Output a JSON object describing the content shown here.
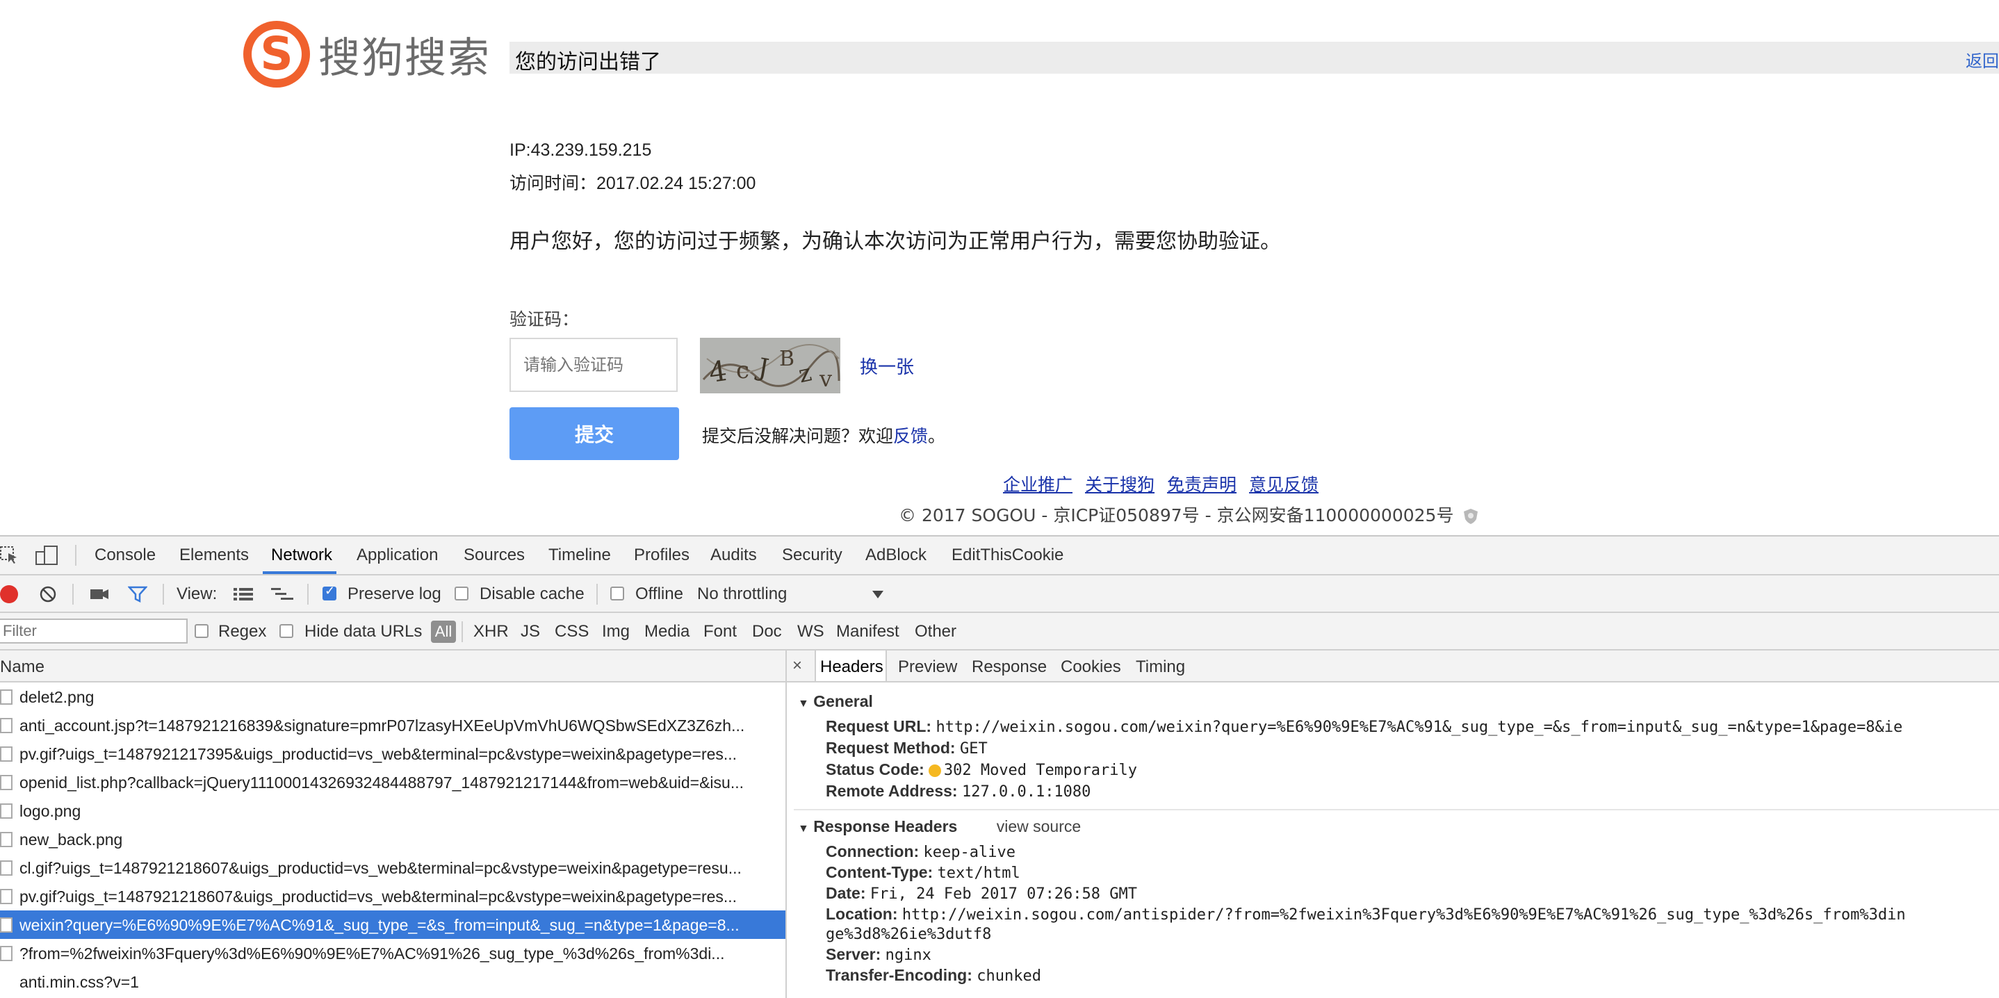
{
  "sogou": {
    "logo_text": "搜狗搜索",
    "logo_letter": "S",
    "title": "您的访问出错了",
    "back_link": "返回",
    "ip": "IP:43.239.159.215",
    "visit_time": "访问时间：2017.02.24 15:27:00",
    "message": "用户您好，您的访问过于频繁，为确认本次访问为正常用户行为，需要您协助验证。",
    "captcha_label": "验证码：",
    "captcha_placeholder": "请输入验证码",
    "refresh_link": "换一张",
    "submit_label": "提交",
    "after_text": "提交后没解决问题？欢迎",
    "after_link": "反馈",
    "after_end": "。",
    "footer_links": [
      "企业推广",
      "关于搜狗",
      "免责声明",
      "意见反馈"
    ],
    "copyright": "© 2017 SOGOU - 京ICP证050897号 - 京公网安备110000000025号"
  },
  "devtools": {
    "tabs": [
      "Console",
      "Elements",
      "Network",
      "Application",
      "Sources",
      "Timeline",
      "Profiles",
      "Audits",
      "Security",
      "AdBlock",
      "EditThisCookie"
    ],
    "active_tab": "Network",
    "toolbar": {
      "view_label": "View:",
      "preserve_log": "Preserve log",
      "disable_cache": "Disable cache",
      "offline": "Offline",
      "throttling": "No throttling"
    },
    "filter": {
      "placeholder": "Filter",
      "regex": "Regex",
      "hide_data_urls": "Hide data URLs",
      "types": [
        "All",
        "XHR",
        "JS",
        "CSS",
        "Img",
        "Media",
        "Font",
        "Doc",
        "WS",
        "Manifest",
        "Other"
      ]
    },
    "list_header": "Name",
    "requests": [
      "delet2.png",
      "anti_account.jsp?t=1487921216839&signature=pmrP07lzasyHXEeUpVmVhU6WQSbwSEdXZ3Z6zh...",
      "pv.gif?uigs_t=1487921217395&uigs_productid=vs_web&terminal=pc&vstype=weixin&pagetype=res...",
      "openid_list.php?callback=jQuery111000143269324844887​97_1487921217144&from=web&uid=&isu...",
      "logo.png",
      "new_back.png",
      "cl.gif?uigs_t=1487921218607&uigs_productid=vs_web&terminal=pc&vstype=weixin&pagetype=resu...",
      "pv.gif?uigs_t=1487921218607&uigs_productid=vs_web&terminal=pc&vstype=weixin&pagetype=res...",
      "weixin?query=%E6%90%9E%E7%AC%91&_sug_type_=&s_from=input&_sug_=n&type=1&page=8...",
      "?from=%2fweixin%3Fquery%3d%E6%90%9E%E7%AC%91%26_sug_type_%3d%26s_from%3di...",
      "anti.min.css?v=1"
    ],
    "detail_tabs": [
      "Headers",
      "Preview",
      "Response",
      "Cookies",
      "Timing"
    ],
    "general": {
      "title": "General",
      "request_url_k": "Request URL:",
      "request_url_v": "http://weixin.sogou.com/weixin?query=%E6%90%9E%E7%AC%91&_sug_type_=&s_from=input&_sug_=n&type=1&page=8&ie",
      "method_k": "Request Method:",
      "method_v": "GET",
      "status_k": "Status Code:",
      "status_v": "302 Moved Temporarily",
      "remote_k": "Remote Address:",
      "remote_v": "127.0.0.1:1080"
    },
    "response_headers": {
      "title": "Response Headers",
      "view_source": "view source",
      "connection_k": "Connection:",
      "connection_v": "keep-alive",
      "ctype_k": "Content-Type:",
      "ctype_v": "text/html",
      "date_k": "Date:",
      "date_v": "Fri, 24 Feb 2017 07:26:58 GMT",
      "location_k": "Location:",
      "location_v1": "http://weixin.sogou.com/antispider/?from=%2fweixin%3Fquery%3d%E6%90%9E%E7%AC%91%26_sug_type_%3d%26s_from%3din",
      "location_v2": "ge%3d8%26ie%3dutf8",
      "server_k": "Server:",
      "server_v": "nginx",
      "te_k": "Transfer-Encoding:",
      "te_v": "chunked"
    }
  },
  "colors": {
    "accent": "#3879d9",
    "sogou_orange": "#f0612d",
    "submit_blue": "#5d9cf5",
    "arrow_red": "#e8343f"
  }
}
